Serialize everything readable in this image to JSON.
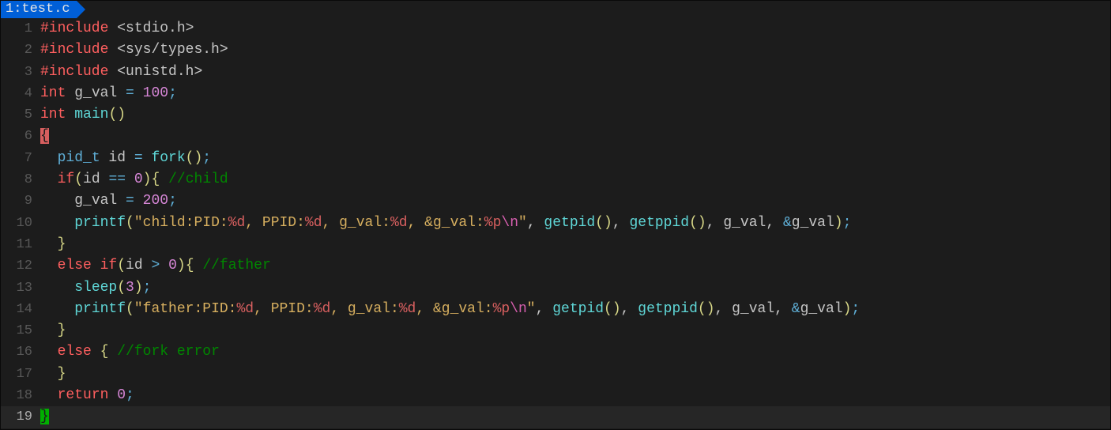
{
  "tab": {
    "index": "1",
    "sep": ": ",
    "filename": "test.c"
  },
  "gutter": {
    "l1": "1",
    "l2": "2",
    "l3": "3",
    "l4": "4",
    "l5": "5",
    "l6": "6",
    "l7": "7",
    "l8": "8",
    "l9": "9",
    "l10": "10",
    "l11": "11",
    "l12": "12",
    "l13": "13",
    "l14": "14",
    "l15": "15",
    "l16": "16",
    "l17": "17",
    "l18": "18",
    "l19": "19"
  },
  "code": {
    "l1": {
      "kw": "#include",
      "sp": " ",
      "rest": "<stdio.h>"
    },
    "l2": {
      "kw": "#include",
      "sp": " ",
      "rest": "<sys/types.h>"
    },
    "l3": {
      "kw": "#include",
      "sp": " ",
      "rest": "<unistd.h>"
    },
    "l4": {
      "kw": "int",
      "sp": " ",
      "id": "g_val ",
      "op": "=",
      "sp2": " ",
      "num": "100",
      "semi": ";"
    },
    "l5": {
      "kw": "int",
      "sp": " ",
      "fn": "main",
      "po": "(",
      "pc": ")"
    },
    "l6": {
      "brace": "{"
    },
    "l7": {
      "pad": "  ",
      "type": "pid_t ",
      "id": "id ",
      "op": "=",
      "sp": " ",
      "fn": "fork",
      "po": "(",
      "pc": ")",
      "semi": ";"
    },
    "l8": {
      "pad": "  ",
      "kw": "if",
      "po": "(",
      "id": "id ",
      "op": "==",
      "sp": " ",
      "num": "0",
      "pc": ")",
      "brace": "{",
      "sp2": " ",
      "cm": "//child"
    },
    "l9": {
      "pad": "    ",
      "id": "g_val ",
      "op": "=",
      "sp": " ",
      "num": "200",
      "semi": ";"
    },
    "l10": {
      "pad": "    ",
      "fn": "printf",
      "po": "(",
      "q1": "\"",
      "s1": "child:PID:",
      "f1": "%d",
      "s2": ", PPID:",
      "f2": "%d",
      "s3": ", g_val:",
      "f3": "%d",
      "s4": ", &g_val:",
      "f4": "%p",
      "esc": "\\n",
      "q2": "\"",
      "c1": ", ",
      "fn2": "getpid",
      "po2": "(",
      "pc2": ")",
      "c2": ", ",
      "fn3": "getppid",
      "po3": "(",
      "pc3": ")",
      "c3": ", ",
      "id1": "g_val",
      "c4": ", ",
      "amp": "&",
      "id2": "g_val",
      "pc": ")",
      "semi": ";"
    },
    "l11": {
      "pad": "  ",
      "brace": "}"
    },
    "l12": {
      "pad": "  ",
      "kw": "else if",
      "po": "(",
      "id": "id ",
      "op": ">",
      "sp": " ",
      "num": "0",
      "pc": ")",
      "brace": "{",
      "sp2": " ",
      "cm": "//father"
    },
    "l13": {
      "pad": "    ",
      "fn": "sleep",
      "po": "(",
      "num": "3",
      "pc": ")",
      "semi": ";"
    },
    "l14": {
      "pad": "    ",
      "fn": "printf",
      "po": "(",
      "q1": "\"",
      "s1": "father:PID:",
      "f1": "%d",
      "s2": ", PPID:",
      "f2": "%d",
      "s3": ", g_val:",
      "f3": "%d",
      "s4": ", &g_val:",
      "f4": "%p",
      "esc": "\\n",
      "q2": "\"",
      "c1": ", ",
      "fn2": "getpid",
      "po2": "(",
      "pc2": ")",
      "c2": ", ",
      "fn3": "getppid",
      "po3": "(",
      "pc3": ")",
      "c3": ", ",
      "id1": "g_val",
      "c4": ", ",
      "amp": "&",
      "id2": "g_val",
      "pc": ")",
      "semi": ";"
    },
    "l15": {
      "pad": "  ",
      "brace": "}"
    },
    "l16": {
      "pad": "  ",
      "kw": "else",
      "sp": " ",
      "brace": "{",
      "sp2": " ",
      "cm": "//fork error"
    },
    "l17": {
      "pad": "  ",
      "brace": "}"
    },
    "l18": {
      "pad": "  ",
      "kw": "return",
      "sp": " ",
      "num": "0",
      "semi": ";"
    },
    "l19": {
      "brace": "}"
    }
  }
}
